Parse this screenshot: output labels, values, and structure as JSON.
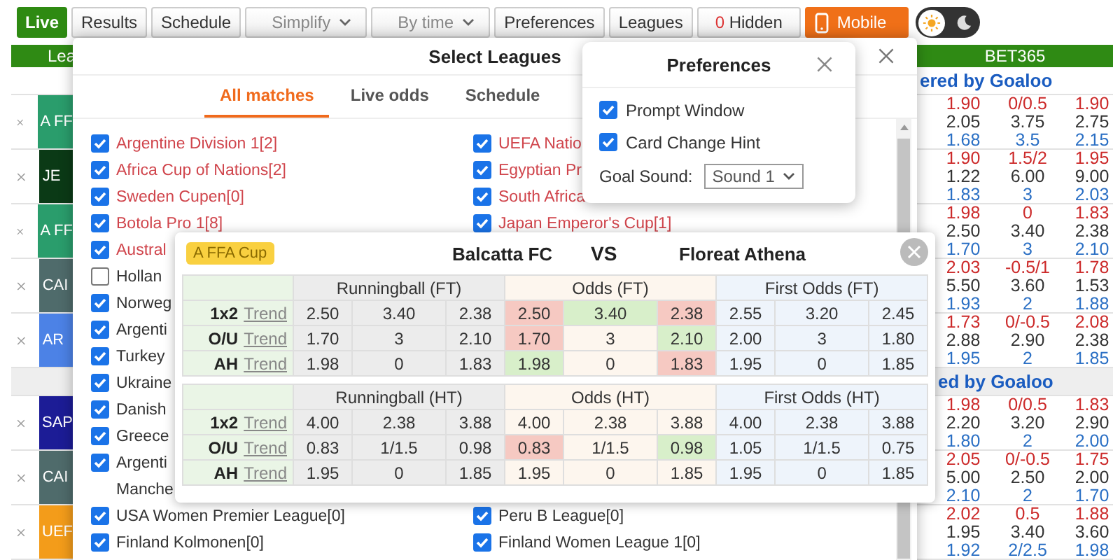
{
  "toolbar": {
    "buttons": [
      {
        "kind": "live",
        "label": "Live"
      },
      {
        "kind": "plain",
        "label": "Results"
      },
      {
        "kind": "plain",
        "label": "Schedule"
      },
      {
        "kind": "dropdown",
        "label": "Simplify"
      },
      {
        "kind": "dropdown",
        "label": "By time"
      },
      {
        "kind": "plain",
        "label": "Preferences"
      },
      {
        "kind": "plain",
        "label": "Leagues"
      },
      {
        "kind": "count",
        "count": "0",
        "label": "Hidden"
      },
      {
        "kind": "mobile",
        "label": "Mobile"
      }
    ],
    "dark_mode": false
  },
  "board": {
    "header": {
      "left": "Lea",
      "right": "BET365"
    },
    "sections": [
      {
        "title": "ered by Goaloo",
        "shaded": false,
        "matches": [
          {
            "league": "A FF",
            "color": "#2a9d6c",
            "ah": [
              "1.90",
              "0/0.5",
              "1.90"
            ],
            "x12": [
              "2.05",
              "3.75",
              "2.75"
            ],
            "ou": [
              "1.68",
              "3.5",
              "2.15"
            ]
          },
          {
            "league": "JE",
            "color": "#0b3a16",
            "ah": [
              "1.90",
              "1.5/2",
              "1.95"
            ],
            "x12": [
              "1.22",
              "6.00",
              "9.00"
            ],
            "ou": [
              "1.83",
              "3",
              "2.03"
            ]
          },
          {
            "league": "A FF",
            "color": "#2a9d6c",
            "ah": [
              "1.98",
              "0",
              "1.83"
            ],
            "x12": [
              "2.50",
              "3.40",
              "2.38"
            ],
            "ou": [
              "1.70",
              "3",
              "2.10"
            ]
          },
          {
            "league": "CAI",
            "color": "#4f6b6b",
            "ah": [
              "2.03",
              "-0.5/1",
              "1.78"
            ],
            "x12": [
              "5.50",
              "3.60",
              "1.53"
            ],
            "ou": [
              "1.93",
              "2",
              "1.88"
            ]
          },
          {
            "league": "AR",
            "color": "#4c82e6",
            "ah": [
              "1.73",
              "0/-0.5",
              "2.08"
            ],
            "x12": [
              "2.88",
              "2.90",
              "2.38"
            ],
            "ou": [
              "1.95",
              "2",
              "1.85"
            ]
          }
        ]
      },
      {
        "title": "ed by Goaloo",
        "shaded": true,
        "matches": [
          {
            "league": "SAP",
            "color": "#1c1c96",
            "ah": [
              "1.98",
              "0/0.5",
              "1.83"
            ],
            "x12": [
              "2.20",
              "3.20",
              "2.90"
            ],
            "ou": [
              "1.80",
              "2",
              "2.00"
            ]
          },
          {
            "league": "CAI",
            "color": "#4f6b6b",
            "ah": [
              "2.05",
              "0/-0.5",
              "1.75"
            ],
            "x12": [
              "5.00",
              "2.50",
              "2.00"
            ],
            "ou": [
              "2.10",
              "2",
              "1.70"
            ]
          },
          {
            "league": "UEF",
            "color": "#f39c1a",
            "ah": [
              "2.02",
              "0.5",
              "1.88"
            ],
            "x12": [
              "1.95",
              "3.40",
              "3.60"
            ],
            "ou": [
              "1.92",
              "2/2.5",
              "1.98"
            ]
          }
        ]
      }
    ]
  },
  "select_leagues": {
    "title": "Select Leagues",
    "tabs": [
      {
        "label": "All matches",
        "selected": true
      },
      {
        "label": "Live odds",
        "selected": false
      },
      {
        "label": "Schedule",
        "selected": false
      }
    ],
    "left_column": [
      {
        "kind": "checkbox",
        "label": "Argentine Division 1[2]",
        "checked": true,
        "color": "#d0454c"
      },
      {
        "kind": "checkbox",
        "label": "Africa Cup of Nations[2]",
        "checked": true,
        "color": "#d0454c"
      },
      {
        "kind": "checkbox",
        "label": "Sweden Cupen[0]",
        "checked": true,
        "color": "#d0454c"
      },
      {
        "kind": "checkbox",
        "label": "Botola Pro 1[8]",
        "checked": true,
        "color": "#d0454c"
      },
      {
        "kind": "checkbox",
        "label": "Austral",
        "checked": true,
        "color": "#d0454c"
      },
      {
        "kind": "checkbox",
        "label": "Hollan",
        "checked": false,
        "color": "#333333"
      },
      {
        "kind": "checkbox",
        "label": "Norweg",
        "checked": true,
        "color": "#333333"
      },
      {
        "kind": "checkbox",
        "label": "Argenti",
        "checked": true,
        "color": "#333333"
      },
      {
        "kind": "checkbox",
        "label": "Turkey",
        "checked": true,
        "color": "#333333"
      },
      {
        "kind": "checkbox",
        "label": "Ukraine",
        "checked": true,
        "color": "#333333"
      },
      {
        "kind": "checkbox",
        "label": "Danish",
        "checked": true,
        "color": "#333333"
      },
      {
        "kind": "checkbox",
        "label": "Greece",
        "checked": true,
        "color": "#333333"
      },
      {
        "kind": "checkbox",
        "label": "Argenti",
        "checked": true,
        "color": "#333333"
      },
      {
        "kind": "text",
        "label": "Manche",
        "color": "#333333"
      },
      {
        "kind": "checkbox",
        "label": "USA Women Premier League[0]",
        "checked": true,
        "color": "#333333"
      },
      {
        "kind": "checkbox",
        "label": "Finland Kolmonen[0]",
        "checked": true,
        "color": "#333333"
      }
    ],
    "right_column_groups": [
      {
        "items": [
          {
            "kind": "checkbox",
            "label": "UEFA Natio",
            "checked": true,
            "color": "#d0454c"
          },
          {
            "kind": "checkbox",
            "label": "Egyptian Pr",
            "checked": true,
            "color": "#d0454c"
          },
          {
            "kind": "checkbox",
            "label": "South Africa",
            "checked": true,
            "color": "#d0454c"
          },
          {
            "kind": "checkbox",
            "label": "Japan Emperor's Cup[1]",
            "checked": true,
            "color": "#d0454c"
          }
        ]
      },
      {
        "items": [
          {
            "kind": "checkbox",
            "label": "Peru B League[0]",
            "checked": true,
            "color": "#333333"
          },
          {
            "kind": "checkbox",
            "label": "Finland Women League 1[0]",
            "checked": true,
            "color": "#333333"
          }
        ]
      }
    ]
  },
  "preferences": {
    "title": "Preferences",
    "options": [
      {
        "label": "Prompt Window",
        "checked": true
      },
      {
        "label": "Card Change Hint",
        "checked": true
      }
    ],
    "goal_sound": {
      "label": "Goal Sound:",
      "value": "Sound 1"
    }
  },
  "match": {
    "league": "A FFA Cup",
    "home": "Balcatta FC",
    "vs": "VS",
    "away": "Floreat Athena",
    "tables": [
      {
        "groups": [
          "Runningball (FT)",
          "Odds (FT)",
          "First Odds (FT)"
        ],
        "rows": [
          {
            "market": "1x2",
            "link": "Trend",
            "runningball": [
              "2.50",
              "3.40",
              "2.38"
            ],
            "odds": [
              {
                "value": "2.50",
                "color": "#f6c9c2"
              },
              {
                "value": "3.40",
                "color": "#d8efca"
              },
              {
                "value": "2.38",
                "color": "#f6c9c2"
              }
            ],
            "first": [
              "2.55",
              "3.20",
              "2.45"
            ]
          },
          {
            "market": "O/U",
            "link": "Trend",
            "runningball": [
              "1.70",
              "3",
              "2.10"
            ],
            "odds": [
              {
                "value": "1.70",
                "color": "#f6c9c2"
              },
              {
                "value": "3",
                "color": "#fdf6ee"
              },
              {
                "value": "2.10",
                "color": "#d8efca"
              }
            ],
            "first": [
              "2.00",
              "3",
              "1.80"
            ]
          },
          {
            "market": "AH",
            "link": "Trend",
            "runningball": [
              "1.98",
              "0",
              "1.83"
            ],
            "odds": [
              {
                "value": "1.98",
                "color": "#d8efca"
              },
              {
                "value": "0",
                "color": "#fdf6ee"
              },
              {
                "value": "1.83",
                "color": "#f6c9c2"
              }
            ],
            "first": [
              "1.95",
              "0",
              "1.85"
            ]
          }
        ]
      },
      {
        "groups": [
          "Runningball (HT)",
          "Odds (HT)",
          "First Odds (HT)"
        ],
        "rows": [
          {
            "market": "1x2",
            "link": "Trend",
            "runningball": [
              "4.00",
              "2.38",
              "3.88"
            ],
            "odds": [
              {
                "value": "4.00",
                "color": "#fdf6ee"
              },
              {
                "value": "2.38",
                "color": "#fdf6ee"
              },
              {
                "value": "3.88",
                "color": "#fdf6ee"
              }
            ],
            "first": [
              "4.00",
              "2.38",
              "3.88"
            ]
          },
          {
            "market": "O/U",
            "link": "Trend",
            "runningball": [
              "0.83",
              "1/1.5",
              "0.98"
            ],
            "odds": [
              {
                "value": "0.83",
                "color": "#f6c9c2"
              },
              {
                "value": "1/1.5",
                "color": "#fdf6ee"
              },
              {
                "value": "0.98",
                "color": "#d8efca"
              }
            ],
            "first": [
              "1.05",
              "1/1.5",
              "0.75"
            ]
          },
          {
            "market": "AH",
            "link": "Trend",
            "runningball": [
              "1.95",
              "0",
              "1.85"
            ],
            "odds": [
              {
                "value": "1.95",
                "color": "#fdf6ee"
              },
              {
                "value": "0",
                "color": "#fdf6ee"
              },
              {
                "value": "1.85",
                "color": "#fdf6ee"
              }
            ],
            "first": [
              "1.95",
              "0",
              "1.85"
            ]
          }
        ]
      }
    ]
  }
}
